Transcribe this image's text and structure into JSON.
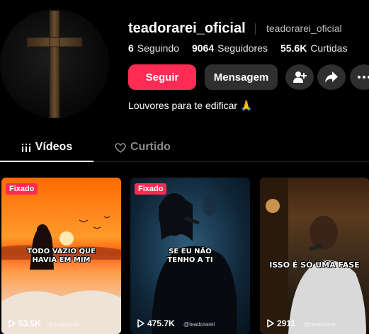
{
  "profile": {
    "username": "teadorarei_oficial",
    "nickname": "teadorarei_oficial",
    "bio": "Louvores para te edificar 🙏",
    "avatar_icon": "cross-icon"
  },
  "stats": {
    "following_count": "6",
    "following_label": "Seguindo",
    "followers_count": "9064",
    "followers_label": "Seguidores",
    "likes_count": "55.6K",
    "likes_label": "Curtidas"
  },
  "actions": {
    "follow_label": "Seguir",
    "message_label": "Mensagem",
    "add_user_icon": "add-user-icon",
    "share_icon": "share-icon",
    "more_icon": "more-icon"
  },
  "tabs": {
    "videos_label": "Vídeos",
    "liked_label": "Curtido"
  },
  "videos": [
    {
      "pinned_label": "Fixado",
      "caption": "TODO VAZIO QUE\nHAVIA EM MIM",
      "views": "53.5K",
      "watermark": "@teadorarei"
    },
    {
      "pinned_label": "Fixado",
      "caption": "SE EU NÃO\nTENHO A TI",
      "views": "475.7K",
      "watermark": "@teadorarei"
    },
    {
      "pinned_label": "",
      "caption": "ISSO É SÓ UMA FASE",
      "views": "2911",
      "watermark": "@teadorarei"
    }
  ],
  "colors": {
    "accent": "#fe2c55",
    "background": "#000000",
    "button_secondary": "#2f2f2f"
  }
}
